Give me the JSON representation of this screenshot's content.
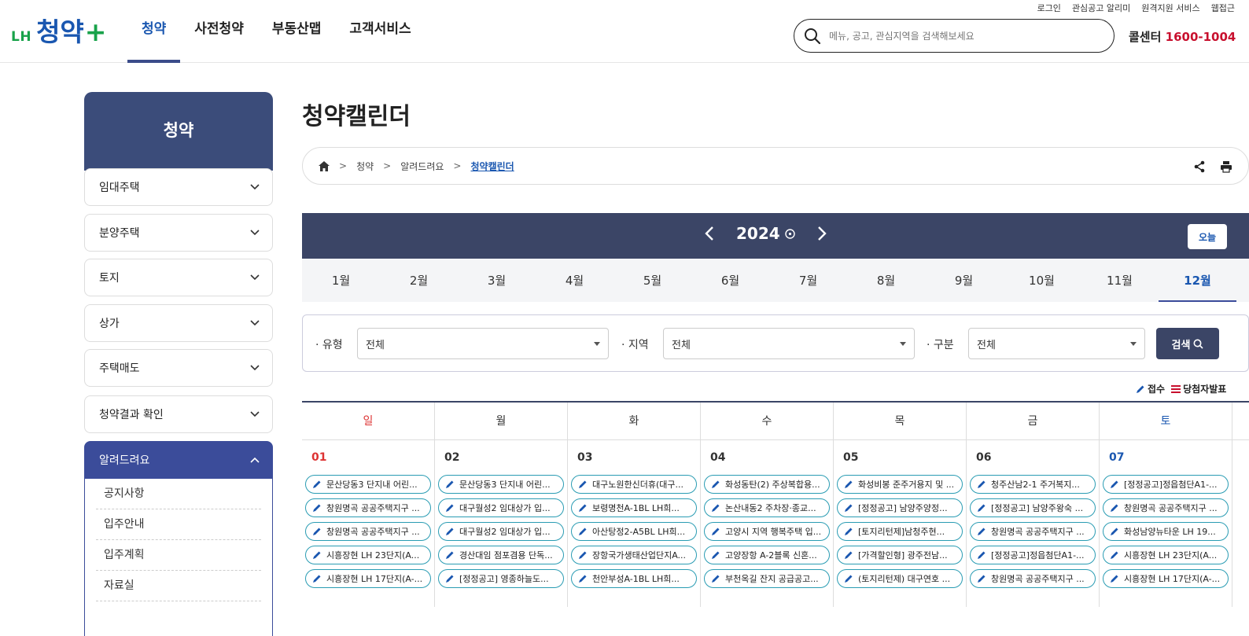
{
  "util_links": [
    "로그인",
    "관심공고 알리미",
    "원격지원 서비스",
    "웹접근"
  ],
  "logo": {
    "lh": "LH",
    "main": "청약",
    "plus": "+"
  },
  "gnb": [
    "청약",
    "사전청약",
    "부동산맵",
    "고객서비스"
  ],
  "search": {
    "placeholder": "메뉴, 공고, 관심지역을 검색해보세요"
  },
  "callcenter": {
    "label": "콜센터",
    "number": "1600-1004"
  },
  "lnb": {
    "title": "청약",
    "items": [
      "임대주택",
      "분양주택",
      "토지",
      "상가",
      "주택매도",
      "청약결과 확인",
      "알려드려요"
    ],
    "sub_items": [
      "공지사항",
      "입주안내",
      "입주계획",
      "자료실"
    ]
  },
  "page_title": "청약캘린더",
  "breadcrumb": [
    "청약",
    "알려드려요",
    "청약캘린더"
  ],
  "calendar": {
    "year": "2024",
    "today_label": "오늘",
    "months": [
      "1월",
      "2월",
      "3월",
      "4월",
      "5월",
      "6월",
      "7월",
      "8월",
      "9월",
      "10월",
      "11월",
      "12월"
    ],
    "active_month": "12월"
  },
  "filters": {
    "type_label": "유형",
    "type_value": "전체",
    "region_label": "지역",
    "region_value": "전체",
    "category_label": "구분",
    "category_value": "전체",
    "search_label": "검색"
  },
  "legend": {
    "receive": "접수",
    "winner": "당첨자발표"
  },
  "weekdays": [
    "일",
    "월",
    "화",
    "수",
    "목",
    "금",
    "토"
  ],
  "days": [
    {
      "num": "01",
      "events": [
        "문산당동3 단지내 어린...",
        "창원명곡 공공주택지구 ...",
        "창원명곡 공공주택지구 ...",
        "시흥장현 LH 23단지(A...",
        "시흥장현 LH 17단지(A-..."
      ]
    },
    {
      "num": "02",
      "events": [
        "문산당동3 단지내 어린...",
        "대구월성2 임대상가 입...",
        "대구월성2 임대상가 입...",
        "경산대임 점포겸용 단독...",
        "[정정공고] 영종하늘도..."
      ]
    },
    {
      "num": "03",
      "events": [
        "대구노원한신더휴(대구...",
        "보령명천A-1BL LH희...",
        "아산탕정2-A5BL LH희...",
        "장항국가생태산업단지A...",
        "천안부성A-1BL LH희..."
      ]
    },
    {
      "num": "04",
      "events": [
        "화성동탄(2) 주상복합용...",
        "논산내동2 주차장·종교...",
        "고양시 지역 행복주택 입...",
        "고양장항 A-2블록 신혼...",
        "부천옥길 잔지 공급공고..."
      ]
    },
    {
      "num": "05",
      "events": [
        "화성비봉 준주거용지 및 ...",
        "[정정공고] 남양주양정...",
        "[토지리턴제]남청주현...",
        "[가격할인형] 광주전남...",
        "(토지리턴제) 대구연호 ..."
      ]
    },
    {
      "num": "06",
      "events": [
        "청주산남2-1 주거복지...",
        "[정정공고] 남양주왕숙 ...",
        "창원명곡 공공주택지구 ...",
        "[정정공고]정읍첨단A1-...",
        "창원명곡 공공주택지구 ..."
      ]
    },
    {
      "num": "07",
      "events": [
        "[정정공고]정읍첨단A1-...",
        "창원명곡 공공주택지구 ...",
        "화성남양뉴타운 LH 19...",
        "시흥장현 LH 23단지(A...",
        "시흥장현 LH 17단지(A-..."
      ]
    }
  ],
  "colors": {
    "brand_blue": "#1a57b0",
    "brand_green": "#18a24a",
    "header_navy": "#3b4566",
    "event_border": "#2a9cb3",
    "sunday": "#dd3333"
  }
}
